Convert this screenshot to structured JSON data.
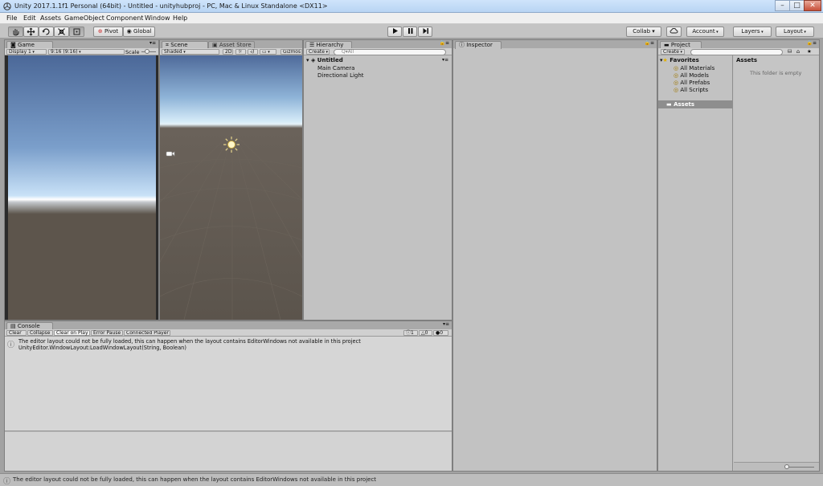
{
  "window": {
    "title": "Unity 2017.1.1f1 Personal (64bit) - Untitled - unityhubproj - PC, Mac & Linux Standalone <DX11>",
    "buttons": [
      "–",
      "□",
      "✕"
    ]
  },
  "menu": [
    "File",
    "Edit",
    "Assets",
    "GameObject",
    "Component",
    "Window",
    "Help"
  ],
  "toolbar": {
    "tools": [
      "hand-tool",
      "move-tool",
      "rotate-tool",
      "scale-tool",
      "rect-tool"
    ],
    "pivot": "Pivot",
    "global": "Global",
    "collab": "Collab ▾",
    "account": "Account",
    "layers": "Layers",
    "layout": "Layout"
  },
  "game": {
    "tab": "Game",
    "display": "Display 1",
    "aspect": "9:16 (9:16)",
    "scale_label": "Scale"
  },
  "scene": {
    "tab": "Scene",
    "tab2": "Asset Store",
    "shading": "Shaded",
    "mode_2d": "2D",
    "gizmos": "Gizmos"
  },
  "hierarchy": {
    "tab": "Hierarchy",
    "create": "Create",
    "search_placeholder": "Q▾All",
    "scene_name": "Untitled",
    "items": [
      "Main Camera",
      "Directional Light"
    ]
  },
  "inspector": {
    "tab": "Inspector"
  },
  "project": {
    "tab": "Project",
    "create": "Create",
    "favorites": "Favorites",
    "favorite_items": [
      "All Materials",
      "All Models",
      "All Prefabs",
      "All Scripts"
    ],
    "assets_folder": "Assets",
    "assets_header": "Assets",
    "empty_message": "This folder is empty"
  },
  "console": {
    "tab": "Console",
    "buttons": [
      "Clear",
      "Collapse",
      "Clear on Play",
      "Error Pause",
      "Connected Player"
    ],
    "counts": {
      "info": "1",
      "warn": "0",
      "error": "0"
    },
    "message_line1": "The editor layout could not be fully loaded, this can happen when the layout contains EditorWindows not available in this project",
    "message_line2": "UnityEditor.WindowLayout:LoadWindowLayout(String, Boolean)"
  },
  "status": {
    "message": "The editor layout could not be fully loaded, this can happen when the layout contains EditorWindows not available in this project"
  },
  "colors": {
    "panel_bg": "#c2c2c2",
    "selection": "#8e8e8e",
    "sky_top": "#4f6f9f",
    "ground": "#5e564d"
  }
}
